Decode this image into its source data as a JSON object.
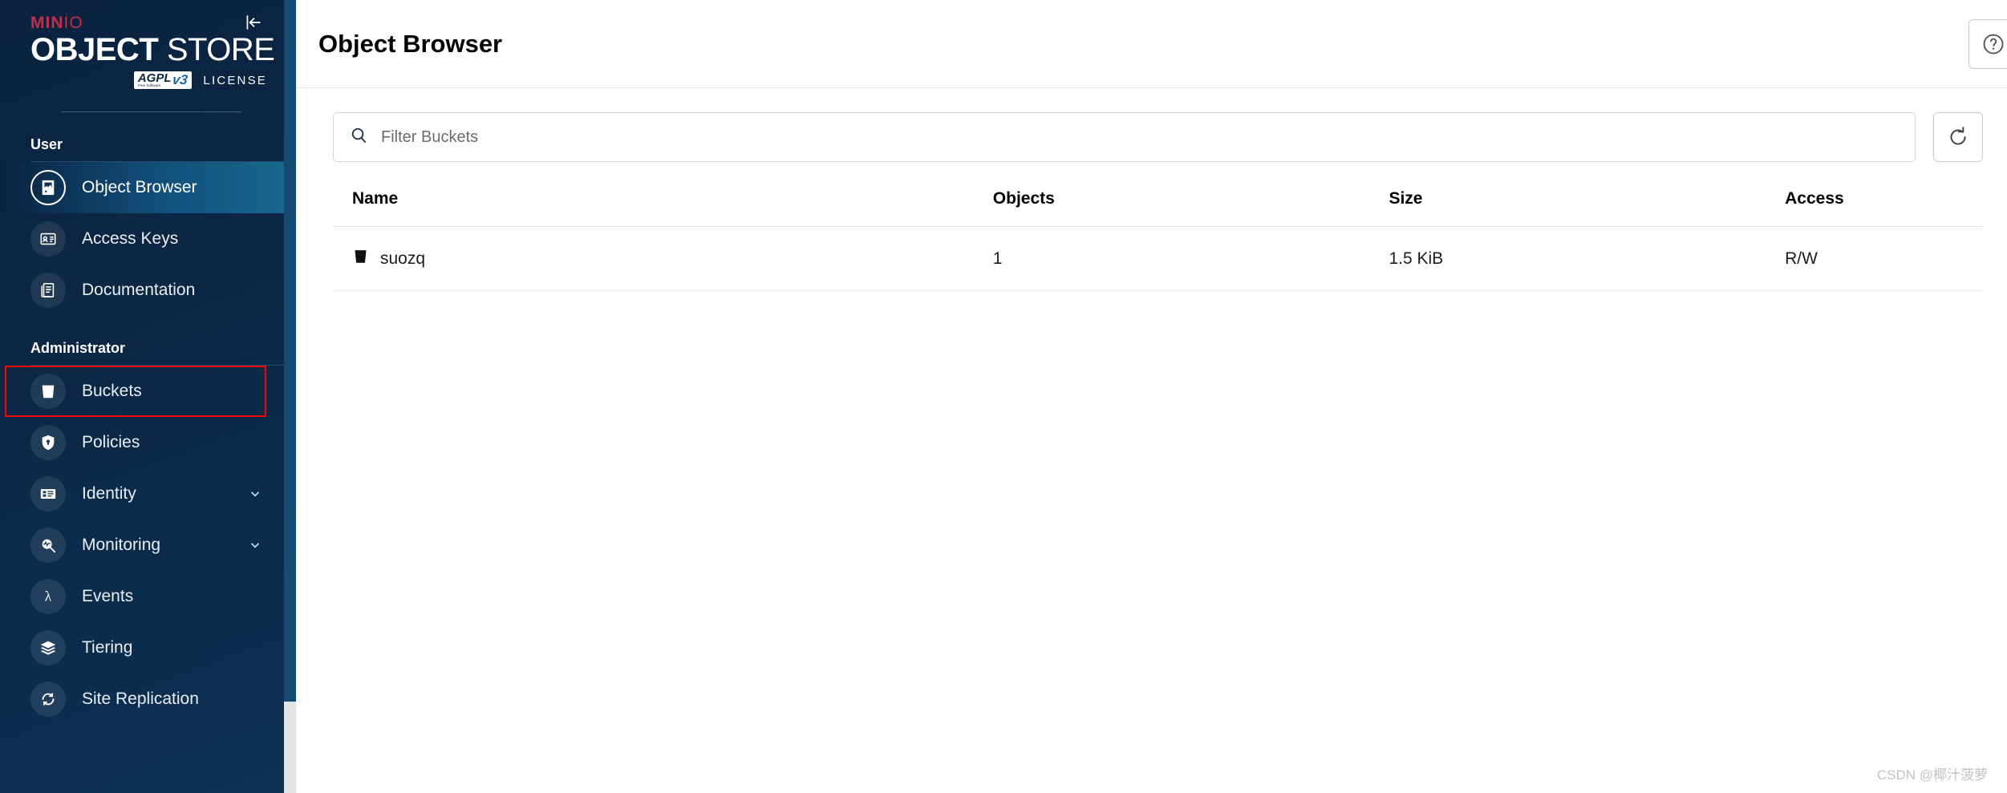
{
  "brand": {
    "minio_main": "MIN",
    "minio_io": "IO",
    "product_bold": "OBJECT",
    "product_light": " STORE",
    "license_badge": "AGPL",
    "license_badge_sub": "Free Software",
    "license_version": "v3",
    "license_text": "LICENSE",
    "collapse_icon": "collapse-sidebar-icon"
  },
  "sidebar": {
    "sections": [
      {
        "label": "User",
        "items": [
          {
            "label": "Object Browser",
            "icon": "object-browser-icon",
            "active": true,
            "expandable": false
          },
          {
            "label": "Access Keys",
            "icon": "access-keys-icon",
            "active": false,
            "expandable": false
          },
          {
            "label": "Documentation",
            "icon": "documentation-icon",
            "active": false,
            "expandable": false
          }
        ]
      },
      {
        "label": "Administrator",
        "items": [
          {
            "label": "Buckets",
            "icon": "buckets-icon",
            "active": false,
            "expandable": false,
            "annotated": true
          },
          {
            "label": "Policies",
            "icon": "policies-lock-icon",
            "active": false,
            "expandable": false
          },
          {
            "label": "Identity",
            "icon": "identity-card-icon",
            "active": false,
            "expandable": true
          },
          {
            "label": "Monitoring",
            "icon": "monitoring-search-icon",
            "active": false,
            "expandable": true
          },
          {
            "label": "Events",
            "icon": "events-lambda-icon",
            "active": false,
            "expandable": false
          },
          {
            "label": "Tiering",
            "icon": "tiering-layers-icon",
            "active": false,
            "expandable": false
          },
          {
            "label": "Site Replication",
            "icon": "site-replication-icon",
            "active": false,
            "expandable": false
          }
        ]
      }
    ]
  },
  "header": {
    "title": "Object Browser",
    "help_icon": "help-question-icon"
  },
  "search": {
    "placeholder": "Filter Buckets",
    "value": "",
    "icon": "search-icon"
  },
  "actions": {
    "refresh_icon": "refresh-icon"
  },
  "table": {
    "columns": [
      "Name",
      "Objects",
      "Size",
      "Access"
    ],
    "rows": [
      {
        "name": "suozq",
        "objects": "1",
        "size": "1.5 KiB",
        "access": "R/W",
        "icon": "bucket-icon"
      }
    ]
  },
  "watermark": "CSDN @椰汁菠萝",
  "colors": {
    "sidebar_dark": "#0a2240",
    "sidebar_accent": "#17698f",
    "brand_red": "#c72c48",
    "annotation_red": "#ff0000"
  }
}
